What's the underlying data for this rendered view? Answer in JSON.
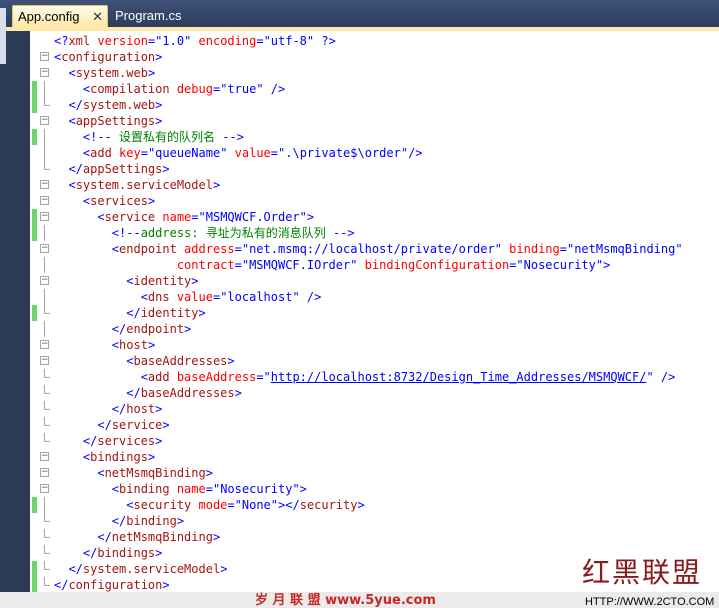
{
  "tabs": [
    {
      "label": "App.config",
      "active": true,
      "close": "✕"
    },
    {
      "label": "Program.cs",
      "active": false
    }
  ],
  "watermark": {
    "logo_text": "红黑联盟",
    "center_text": "岁 月 联 盟  www.5yue.com",
    "url": "HTTP://WWW.2CTO.COM"
  },
  "code": [
    {
      "segs": [
        {
          "c": "p",
          "t": "<?"
        },
        {
          "c": "t",
          "t": "xml"
        },
        {
          "c": "a",
          "t": " version"
        },
        {
          "c": "p",
          "t": "="
        },
        {
          "c": "v",
          "t": "\"1.0\""
        },
        {
          "c": "a",
          "t": " encoding"
        },
        {
          "c": "p",
          "t": "="
        },
        {
          "c": "v",
          "t": "\"utf-8\""
        },
        {
          "c": "p",
          "t": " ?>"
        }
      ]
    },
    {
      "segs": [
        {
          "c": "p",
          "t": "<"
        },
        {
          "c": "t",
          "t": "configuration"
        },
        {
          "c": "p",
          "t": ">"
        }
      ]
    },
    {
      "segs": [
        {
          "c": "p",
          "t": "  <"
        },
        {
          "c": "t",
          "t": "system.web"
        },
        {
          "c": "p",
          "t": ">"
        }
      ]
    },
    {
      "segs": [
        {
          "c": "p",
          "t": "    <"
        },
        {
          "c": "t",
          "t": "compilation"
        },
        {
          "c": "a",
          "t": " debug"
        },
        {
          "c": "p",
          "t": "="
        },
        {
          "c": "v",
          "t": "\"true\""
        },
        {
          "c": "p",
          "t": " />"
        }
      ]
    },
    {
      "segs": [
        {
          "c": "p",
          "t": "  </"
        },
        {
          "c": "t",
          "t": "system.web"
        },
        {
          "c": "p",
          "t": ">"
        }
      ]
    },
    {
      "segs": [
        {
          "c": "p",
          "t": "  <"
        },
        {
          "c": "t",
          "t": "appSettings"
        },
        {
          "c": "p",
          "t": ">"
        }
      ]
    },
    {
      "segs": [
        {
          "c": "p",
          "t": "    <!--"
        },
        {
          "c": "c",
          "t": " 设置私有的队列名 "
        },
        {
          "c": "p",
          "t": "-->"
        }
      ]
    },
    {
      "segs": [
        {
          "c": "p",
          "t": "    <"
        },
        {
          "c": "t",
          "t": "add"
        },
        {
          "c": "a",
          "t": " key"
        },
        {
          "c": "p",
          "t": "="
        },
        {
          "c": "v",
          "t": "\"queueName\""
        },
        {
          "c": "a",
          "t": " value"
        },
        {
          "c": "p",
          "t": "="
        },
        {
          "c": "v",
          "t": "\".\\private$\\order\""
        },
        {
          "c": "p",
          "t": "/>"
        }
      ]
    },
    {
      "segs": [
        {
          "c": "p",
          "t": "  </"
        },
        {
          "c": "t",
          "t": "appSettings"
        },
        {
          "c": "p",
          "t": ">"
        }
      ]
    },
    {
      "segs": [
        {
          "c": "p",
          "t": "  <"
        },
        {
          "c": "t",
          "t": "system.serviceModel"
        },
        {
          "c": "p",
          "t": ">"
        }
      ]
    },
    {
      "segs": [
        {
          "c": "p",
          "t": "    <"
        },
        {
          "c": "t",
          "t": "services"
        },
        {
          "c": "p",
          "t": ">"
        }
      ]
    },
    {
      "segs": [
        {
          "c": "p",
          "t": "      <"
        },
        {
          "c": "t",
          "t": "service"
        },
        {
          "c": "a",
          "t": " name"
        },
        {
          "c": "p",
          "t": "="
        },
        {
          "c": "v",
          "t": "\"MSMQWCF.Order\""
        },
        {
          "c": "p",
          "t": ">"
        }
      ]
    },
    {
      "segs": [
        {
          "c": "p",
          "t": "        <!--"
        },
        {
          "c": "c",
          "t": "address: 寻址为私有的消息队列 "
        },
        {
          "c": "p",
          "t": "-->"
        }
      ]
    },
    {
      "segs": [
        {
          "c": "p",
          "t": "        <"
        },
        {
          "c": "t",
          "t": "endpoint"
        },
        {
          "c": "a",
          "t": " address"
        },
        {
          "c": "p",
          "t": "="
        },
        {
          "c": "v",
          "t": "\"net.msmq://localhost/private/order\""
        },
        {
          "c": "a",
          "t": " binding"
        },
        {
          "c": "p",
          "t": "="
        },
        {
          "c": "v",
          "t": "\"netMsmqBinding\""
        }
      ]
    },
    {
      "segs": [
        {
          "c": "a",
          "t": "                 contract"
        },
        {
          "c": "p",
          "t": "="
        },
        {
          "c": "v",
          "t": "\"MSMQWCF.IOrder\""
        },
        {
          "c": "a",
          "t": " bindingConfiguration"
        },
        {
          "c": "p",
          "t": "="
        },
        {
          "c": "v",
          "t": "\"Nosecurity\""
        },
        {
          "c": "p",
          "t": ">"
        }
      ]
    },
    {
      "segs": [
        {
          "c": "p",
          "t": "          <"
        },
        {
          "c": "t",
          "t": "identity"
        },
        {
          "c": "p",
          "t": ">"
        }
      ]
    },
    {
      "segs": [
        {
          "c": "p",
          "t": "            <"
        },
        {
          "c": "t",
          "t": "dns"
        },
        {
          "c": "a",
          "t": " value"
        },
        {
          "c": "p",
          "t": "="
        },
        {
          "c": "v",
          "t": "\"localhost\""
        },
        {
          "c": "p",
          "t": " />"
        }
      ]
    },
    {
      "segs": [
        {
          "c": "p",
          "t": "          </"
        },
        {
          "c": "t",
          "t": "identity"
        },
        {
          "c": "p",
          "t": ">"
        }
      ]
    },
    {
      "segs": [
        {
          "c": "p",
          "t": "        </"
        },
        {
          "c": "t",
          "t": "endpoint"
        },
        {
          "c": "p",
          "t": ">"
        }
      ]
    },
    {
      "segs": [
        {
          "c": "p",
          "t": "        <"
        },
        {
          "c": "t",
          "t": "host"
        },
        {
          "c": "p",
          "t": ">"
        }
      ]
    },
    {
      "segs": [
        {
          "c": "p",
          "t": "          <"
        },
        {
          "c": "t",
          "t": "baseAddresses"
        },
        {
          "c": "p",
          "t": ">"
        }
      ]
    },
    {
      "segs": [
        {
          "c": "p",
          "t": "            <"
        },
        {
          "c": "t",
          "t": "add"
        },
        {
          "c": "a",
          "t": " baseAddress"
        },
        {
          "c": "p",
          "t": "="
        },
        {
          "c": "v",
          "t": "\""
        },
        {
          "c": "u",
          "t": "http://localhost:8732/Design_Time_Addresses/MSMQWCF/"
        },
        {
          "c": "v",
          "t": "\""
        },
        {
          "c": "p",
          "t": " />"
        }
      ]
    },
    {
      "segs": [
        {
          "c": "p",
          "t": "          </"
        },
        {
          "c": "t",
          "t": "baseAddresses"
        },
        {
          "c": "p",
          "t": ">"
        }
      ]
    },
    {
      "segs": [
        {
          "c": "p",
          "t": "        </"
        },
        {
          "c": "t",
          "t": "host"
        },
        {
          "c": "p",
          "t": ">"
        }
      ]
    },
    {
      "segs": [
        {
          "c": "p",
          "t": "      </"
        },
        {
          "c": "t",
          "t": "service"
        },
        {
          "c": "p",
          "t": ">"
        }
      ]
    },
    {
      "segs": [
        {
          "c": "p",
          "t": "    </"
        },
        {
          "c": "t",
          "t": "services"
        },
        {
          "c": "p",
          "t": ">"
        }
      ]
    },
    {
      "segs": [
        {
          "c": "p",
          "t": "    <"
        },
        {
          "c": "t",
          "t": "bindings"
        },
        {
          "c": "p",
          "t": ">"
        }
      ]
    },
    {
      "segs": [
        {
          "c": "p",
          "t": "      <"
        },
        {
          "c": "t",
          "t": "netMsmqBinding"
        },
        {
          "c": "p",
          "t": ">"
        }
      ]
    },
    {
      "segs": [
        {
          "c": "p",
          "t": "        <"
        },
        {
          "c": "t",
          "t": "binding"
        },
        {
          "c": "a",
          "t": " name"
        },
        {
          "c": "p",
          "t": "="
        },
        {
          "c": "v",
          "t": "\"Nosecurity\""
        },
        {
          "c": "p",
          "t": ">"
        }
      ]
    },
    {
      "segs": [
        {
          "c": "p",
          "t": "          <"
        },
        {
          "c": "t",
          "t": "security"
        },
        {
          "c": "a",
          "t": " mode"
        },
        {
          "c": "p",
          "t": "="
        },
        {
          "c": "v",
          "t": "\"None\""
        },
        {
          "c": "p",
          "t": "></"
        },
        {
          "c": "t",
          "t": "security"
        },
        {
          "c": "p",
          "t": ">"
        }
      ]
    },
    {
      "segs": [
        {
          "c": "p",
          "t": "        </"
        },
        {
          "c": "t",
          "t": "binding"
        },
        {
          "c": "p",
          "t": ">"
        }
      ]
    },
    {
      "segs": [
        {
          "c": "p",
          "t": "      </"
        },
        {
          "c": "t",
          "t": "netMsmqBinding"
        },
        {
          "c": "p",
          "t": ">"
        }
      ]
    },
    {
      "segs": [
        {
          "c": "p",
          "t": "    </"
        },
        {
          "c": "t",
          "t": "bindings"
        },
        {
          "c": "p",
          "t": ">"
        }
      ]
    },
    {
      "segs": [
        {
          "c": "p",
          "t": "  </"
        },
        {
          "c": "t",
          "t": "system.serviceModel"
        },
        {
          "c": "p",
          "t": ">"
        }
      ]
    },
    {
      "segs": [
        {
          "c": "p",
          "t": "</"
        },
        {
          "c": "t",
          "t": "configuration"
        },
        {
          "c": "p",
          "t": ">"
        }
      ]
    }
  ]
}
